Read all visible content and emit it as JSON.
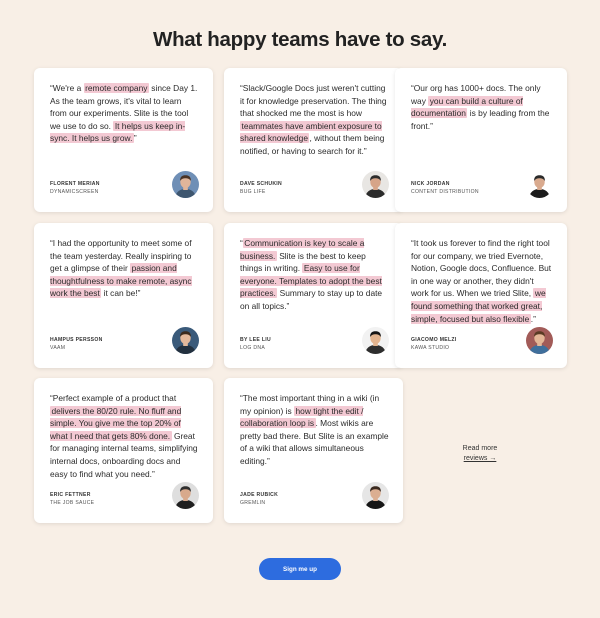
{
  "page": {
    "title": "What happy teams have to say."
  },
  "testimonials": [
    {
      "segments": [
        {
          "t": "“We're a "
        },
        {
          "t": "remote company",
          "hl": true
        },
        {
          "t": " since Day 1. As the team grows, it's vital to learn from our experiments. Slite is the tool we use to do so. "
        },
        {
          "t": "It helps us keep in-sync. It helps us grow.",
          "hl": true
        },
        {
          "t": "”"
        }
      ],
      "name": "FLORENT MERIAN",
      "company": "DYNAMICSCREEN",
      "avatar": {
        "bg": "#6f8fb6",
        "skin": "#e0b59a",
        "hair": "#4a3324",
        "shirt": "#3e566f"
      }
    },
    {
      "segments": [
        {
          "t": "“Slack/Google Docs just weren't cutting it for knowledge preservation. The thing that shocked me the most is how "
        },
        {
          "t": "teammates have ambient exposure to shared knowledge",
          "hl": true
        },
        {
          "t": ", without them being notified, or having to search for it.”"
        }
      ],
      "name": "DAVE SCHUKIN",
      "company": "BUG LIFE",
      "avatar": {
        "bg": "#e8e6e3",
        "skin": "#d6a488",
        "hair": "#2c2c2c",
        "shirt": "#2b2b2b"
      }
    },
    {
      "segments": [
        {
          "t": "“Our org has 1000+ docs. The only way "
        },
        {
          "t": "you can build a culture of documentation",
          "hl": true
        },
        {
          "t": " is by leading from the front.”"
        }
      ],
      "name": "NICK JORDAN",
      "company": "CONTENT DISTRIBUTION",
      "avatar": {
        "bg": "#ffffff",
        "skin": "#d9aa8e",
        "hair": "#2a2a2a",
        "shirt": "#1c1c1c"
      }
    },
    {
      "segments": [
        {
          "t": "“I had the opportunity to meet some of the team yesterday. Really inspiring to get a glimpse of their "
        },
        {
          "t": "passion and thoughtfulness to make remote, async work the best",
          "hl": true
        },
        {
          "t": " it can be!”"
        }
      ],
      "name": "HAMPUS PERSSON",
      "company": "VAAM",
      "avatar": {
        "bg": "#3a5a7a",
        "skin": "#e3b99c",
        "hair": "#3a2a1e",
        "shirt": "#22303f"
      }
    },
    {
      "segments": [
        {
          "t": "“"
        },
        {
          "t": "Communication is key to scale a business.",
          "hl": true
        },
        {
          "t": " Slite is the best to keep things in writing. "
        },
        {
          "t": "Easy to use for everyone. Templates to adopt the best practices.",
          "hl": true
        },
        {
          "t": " Summary to stay up to date on all topics.”"
        }
      ],
      "name": "BY LEE LIU",
      "company": "LOG DNA",
      "avatar": {
        "bg": "#f2f2f2",
        "skin": "#e2b48f",
        "hair": "#151515",
        "shirt": "#2d2d2d"
      }
    },
    {
      "segments": [
        {
          "t": "“It took us forever to find the right tool for our company, we tried Evernote, Notion, Google docs, Confluence. But in one way or another, they didn't work for us. When we tried Slite, "
        },
        {
          "t": "we found something that worked great, simple, focused but also flexible",
          "hl": true
        },
        {
          "t": ".”"
        }
      ],
      "name": "GIACOMO MELZI",
      "company": "KAWA STUDIO",
      "avatar": {
        "bg": "#a25b58",
        "skin": "#e4b797",
        "hair": "#5a3b24",
        "shirt": "#3f6f9c"
      }
    },
    {
      "segments": [
        {
          "t": "“Perfect example of a product that "
        },
        {
          "t": "delivers the 80/20 rule. No fluff and simple. You give me the top 20% of what I need that gets 80% done.",
          "hl": true
        },
        {
          "t": " Great for managing internal teams, simplifying internal docs, onboarding docs and easy to find what you need.”"
        }
      ],
      "name": "ERIC FETTNER",
      "company": "THE JOB SAUCE",
      "avatar": {
        "bg": "#dedede",
        "skin": "#d8a98c",
        "hair": "#2f2f2f",
        "shirt": "#1f1f1f"
      }
    },
    {
      "segments": [
        {
          "t": "“The most important thing in a wiki (in my opinion) is "
        },
        {
          "t": "how tight the edit / collaboration loop is",
          "hl": true
        },
        {
          "t": ". Most wikis are pretty bad there. But Slite is an example of a wiki that allows simultaneous editing.”"
        }
      ],
      "name": "JADE RUBICK",
      "company": "GREMLIN",
      "avatar": {
        "bg": "#e6e6e6",
        "skin": "#dbae91",
        "hair": "#3b2a20",
        "shirt": "#161616"
      }
    }
  ],
  "read_more": {
    "line1": "Read more",
    "line2": "reviews →"
  },
  "cta": {
    "label": "Sign me up",
    "color": "#2d6cdf"
  },
  "colors": {
    "background": "#f8efe6",
    "highlight": "#f3c9d3"
  }
}
